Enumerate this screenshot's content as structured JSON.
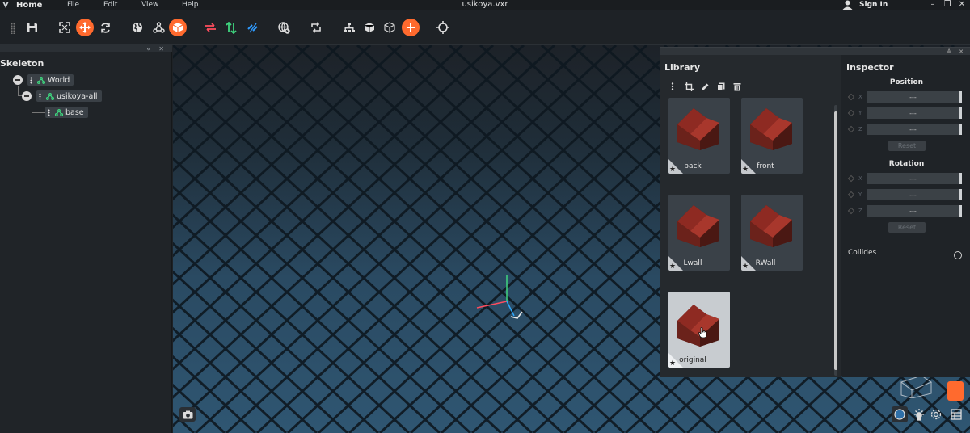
{
  "menubar": {
    "home": "Home",
    "menus": [
      "File",
      "Edit",
      "View",
      "Help"
    ],
    "title": "usikoya.vxr",
    "signin": "Sign In",
    "window_controls": [
      "minimize-icon",
      "restore-icon",
      "close-icon"
    ]
  },
  "toolbar": {
    "icons": [
      "save-icon",
      "fit-view-icon",
      "move-tool-icon",
      "rotate-tool-icon",
      "globe-icon",
      "hierarchy-icon",
      "voxel-cube-icon",
      "swap-icon",
      "sort-icon",
      "link-icon",
      "world-refresh-icon",
      "refresh-icon",
      "tree-icon",
      "solid-cube-icon",
      "wire-cube-icon",
      "add-icon",
      "crosshair-icon"
    ],
    "accent": "#ff6a2e"
  },
  "skeleton": {
    "title": "Skeleton",
    "nodes": [
      {
        "label": "World"
      },
      {
        "label": "usikoya-all"
      },
      {
        "label": "base"
      }
    ]
  },
  "library": {
    "title": "Library",
    "tools": [
      "more-icon",
      "crop-icon",
      "edit-icon",
      "copy-icon",
      "delete-icon"
    ],
    "items": [
      {
        "label": "back"
      },
      {
        "label": "front"
      },
      {
        "label": "Lwall"
      },
      {
        "label": "RWall"
      },
      {
        "label": "original",
        "selected": true
      }
    ]
  },
  "inspector": {
    "title": "Inspector",
    "position": {
      "title": "Position",
      "fields": [
        {
          "axis": "X",
          "value": "---"
        },
        {
          "axis": "Y",
          "value": "---"
        },
        {
          "axis": "Z",
          "value": "---"
        }
      ],
      "reset": "Reset"
    },
    "rotation": {
      "title": "Rotation",
      "fields": [
        {
          "axis": "X",
          "value": "---"
        },
        {
          "axis": "Y",
          "value": "---"
        },
        {
          "axis": "Z",
          "value": "---"
        }
      ],
      "reset": "Reset"
    },
    "collides_label": "Collides"
  }
}
